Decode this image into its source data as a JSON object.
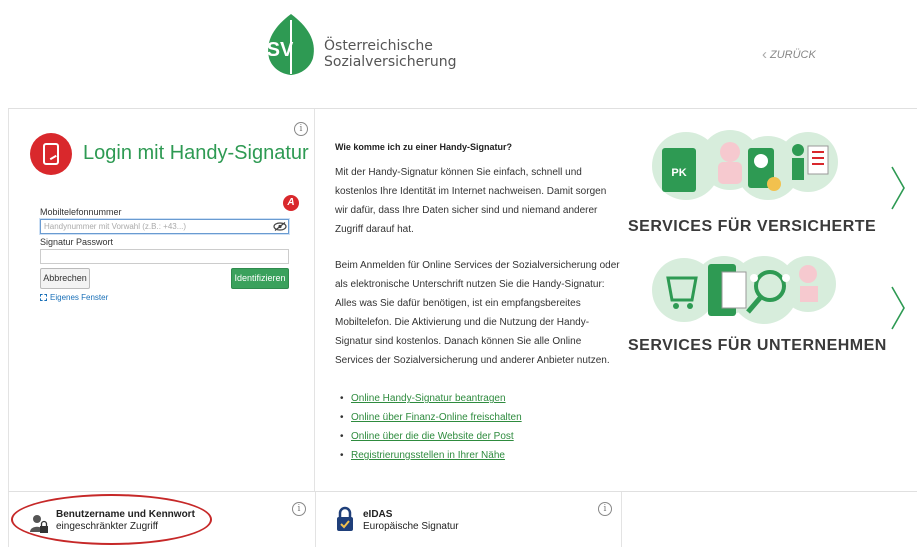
{
  "header": {
    "logo_letters": "SV",
    "logo_line1": "Österreichische",
    "logo_line2": "Sozialversicherung",
    "back_label": "ZURÜCK"
  },
  "login": {
    "title": "Login mit Handy-Signatur",
    "phone_label": "Mobiltelefonnummer",
    "phone_placeholder": "Handynummer mit Vorwahl (z.B.: +43...)",
    "password_label": "Signatur Passwort",
    "cancel_label": "Abbrechen",
    "identify_label": "Identifizieren",
    "own_window_label": "Eigenes Fenster",
    "info_glyph": "i",
    "provider_badge": "A"
  },
  "middle": {
    "heading": "Wie komme ich zu einer Handy-Signatur?",
    "para1": "Mit der Handy-Signatur können Sie einfach, schnell und kostenlos Ihre Identität im Internet nachweisen. Damit sorgen wir dafür, dass Ihre Daten sicher sind und niemand anderer Zugriff darauf hat.",
    "para2": "Beim Anmelden für Online Services der Sozialversicherung oder als elektronische Unterschrift nutzen Sie die Handy-Signatur: Alles was Sie dafür benötigen, ist ein empfangsbereites Mobiltelefon. Die Aktivierung und die Nutzung der Handy-Signatur sind kostenlos. Danach können Sie alle Online Services der Sozialversicherung und anderer Anbieter nutzen.",
    "links": [
      "Online Handy-Signatur beantragen",
      "Online über Finanz-Online freischalten",
      "Online über die die Website der Post",
      "Registrierungsstellen in Ihrer Nähe"
    ]
  },
  "services": {
    "insured_title": "SERVICES FÜR VERSICHERTE",
    "insured_badge": "PK",
    "companies_title": "SERVICES FÜR UNTERNEHMEN"
  },
  "bottom": {
    "user_title": "Benutzername und Kennwort",
    "user_sub": "eingeschränkter Zugriff",
    "eidas_title": "eIDAS",
    "eidas_sub": "Europäische Signatur"
  },
  "colors": {
    "brand_green": "#2e9a53",
    "accent_red": "#d9282c",
    "link_green": "#2e8b3e",
    "circle_green": "#d7eddc",
    "highlight_red": "#c62828"
  }
}
